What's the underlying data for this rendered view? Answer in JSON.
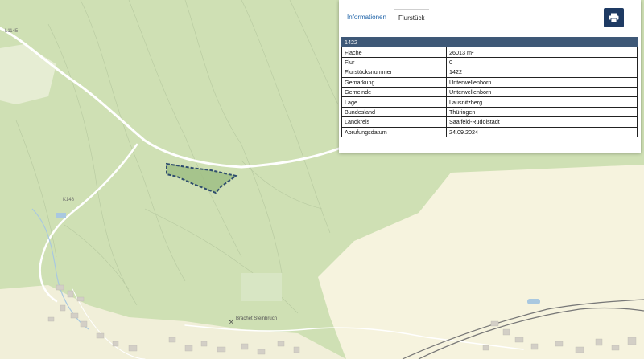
{
  "tabs": [
    {
      "label": "Informationen",
      "active": true
    },
    {
      "label": "Flurstück",
      "active": false
    }
  ],
  "print_icon": "printer-icon",
  "parcel": {
    "header": "1422",
    "rows": [
      {
        "label": "Fläche",
        "value": "26013 m²"
      },
      {
        "label": "Flur",
        "value": "0"
      },
      {
        "label": "Flurstücksnummer",
        "value": "1422"
      },
      {
        "label": "Gemarkung",
        "value": "Unterwellenborn"
      },
      {
        "label": "Gemeinde",
        "value": "Unterwellenborn"
      },
      {
        "label": "Lage",
        "value": "Lausnitzberg"
      },
      {
        "label": "Bundesland",
        "value": "Thüringen"
      },
      {
        "label": "Landkreis",
        "value": "Saalfeld-Rudolstadt"
      },
      {
        "label": "Abrufungsdatum",
        "value": "24.09.2024"
      }
    ]
  },
  "map": {
    "road_labels": [
      "L1145",
      "K148"
    ],
    "poi_label": "Brachet Steinbruch",
    "colors": {
      "forest": "#cfe0b4",
      "field": "#f6f3de",
      "parcel_fill": "#9fbe85",
      "parcel_border": "#2f4d6e",
      "accent": "#1e3a63"
    }
  }
}
